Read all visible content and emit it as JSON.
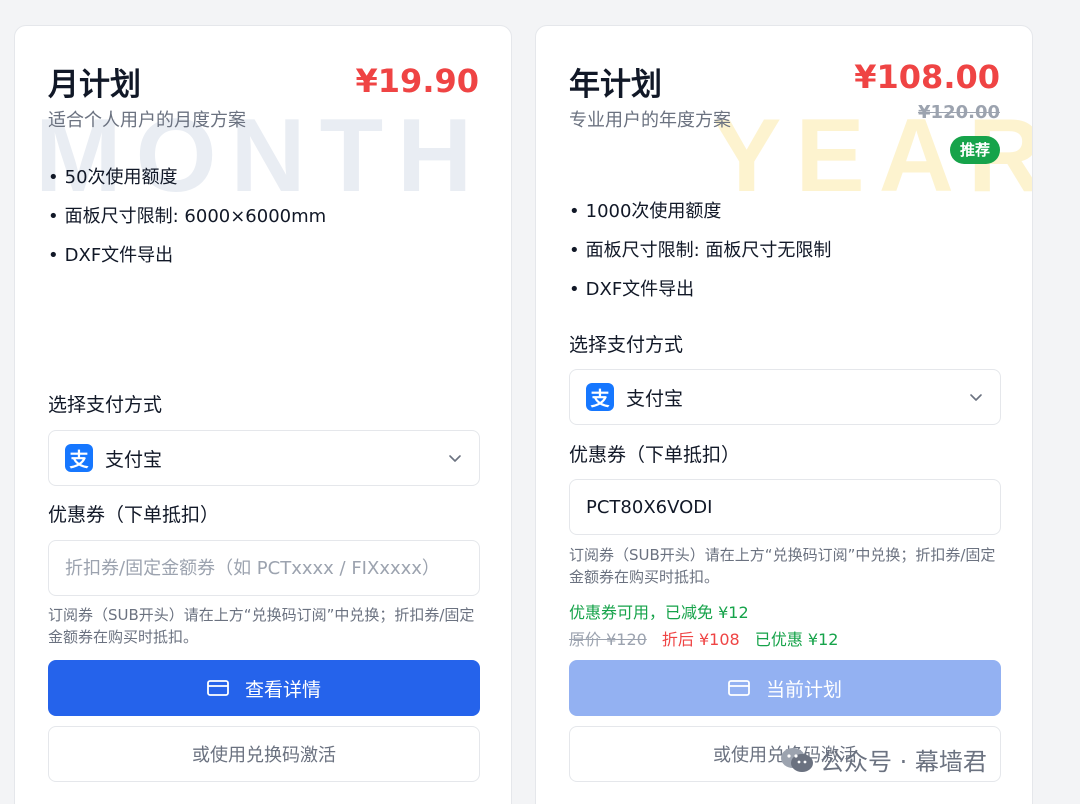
{
  "plans": {
    "month": {
      "watermark": "MONTH",
      "name": "月计划",
      "description": "适合个人用户的月度方案",
      "price": "¥19.90",
      "features": [
        "50次使用额度",
        "面板尺寸限制: 6000×6000mm",
        "DXF文件导出"
      ],
      "payment_label": "选择支付方式",
      "payment_method": "支付宝",
      "coupon_label": "优惠券（下单抵扣）",
      "coupon_value": "",
      "coupon_placeholder": "折扣券/固定金额券（如 PCTxxxx / FIXxxxx）",
      "hint": "订阅券（SUB开头）请在上方“兑换码订阅”中兑换；折扣券/固定金额券在购买时抵扣。",
      "primary_button": "查看详情",
      "secondary_button": "或使用兑换码激活"
    },
    "year": {
      "watermark": "YEAR",
      "name": "年计划",
      "description": "专业用户的年度方案",
      "price": "¥108.00",
      "original_price": "¥120.00",
      "badge": "推荐",
      "features": [
        "1000次使用额度",
        "面板尺寸限制: 面板尺寸无限制",
        "DXF文件导出"
      ],
      "payment_label": "选择支付方式",
      "payment_method": "支付宝",
      "coupon_label": "优惠券（下单抵扣）",
      "coupon_value": "PCT80X6VODI",
      "hint": "订阅券（SUB开头）请在上方“兑换码订阅”中兑换；折扣券/固定金额券在购买时抵扣。",
      "coupon_status": "优惠券可用，已减免 ¥12",
      "price_original_text": "原价 ¥120",
      "price_after_text": "折后 ¥108",
      "price_saved_text": "已优惠 ¥12",
      "primary_button": "当前计划",
      "secondary_button": "或使用兑换码激活"
    }
  },
  "attribution": "公众号 · 幕墙君",
  "icons": {
    "payment": "alipay-icon",
    "dropdown": "chevron-down-icon",
    "button": "credit-card-icon",
    "attribution": "wechat-icon"
  },
  "colors": {
    "primary": "#2563eb",
    "price": "#ef4444",
    "success": "#16a34a",
    "alipay": "#1677ff"
  }
}
